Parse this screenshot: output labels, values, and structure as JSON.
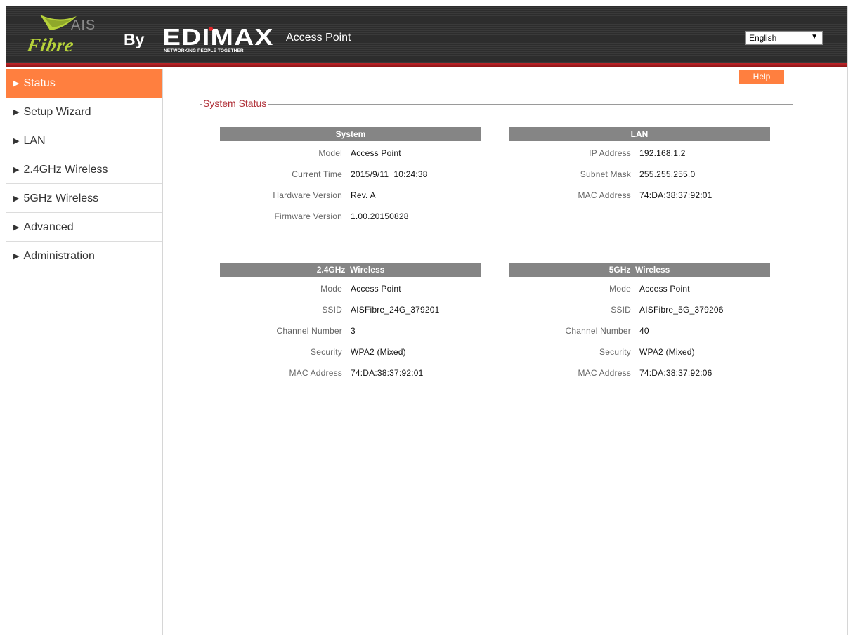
{
  "header": {
    "ais_text": "AIS",
    "fibre_text": "Fibre",
    "by_text": "By",
    "edimax_text": "EDIMAX",
    "edimax_tagline": "NETWORKING PEOPLE TOGETHER",
    "product_name": "Access Point",
    "language": "English"
  },
  "sidebar": {
    "items": [
      {
        "label": "Status",
        "active": true
      },
      {
        "label": "Setup Wizard"
      },
      {
        "label": "LAN"
      },
      {
        "label": "2.4GHz Wireless"
      },
      {
        "label": "5GHz Wireless"
      },
      {
        "label": "Advanced"
      },
      {
        "label": "Administration"
      }
    ]
  },
  "help_label": "Help",
  "status": {
    "legend": "System Status",
    "system": {
      "title": "System",
      "rows": [
        {
          "label": "Model",
          "value": "Access Point"
        },
        {
          "label": "Current Time",
          "value": "2015/9/11  10:24:38"
        },
        {
          "label": "Hardware Version",
          "value": "Rev. A"
        },
        {
          "label": "Firmware Version",
          "value": "1.00.20150828"
        }
      ]
    },
    "lan": {
      "title": "LAN",
      "rows": [
        {
          "label": "IP Address",
          "value": "192.168.1.2"
        },
        {
          "label": "Subnet Mask",
          "value": "255.255.255.0"
        },
        {
          "label": "MAC Address",
          "value": "74:DA:38:37:92:01"
        }
      ]
    },
    "wireless24": {
      "title": "2.4GHz  Wireless",
      "rows": [
        {
          "label": "Mode",
          "value": "Access Point"
        },
        {
          "label": "SSID",
          "value": "AISFibre_24G_379201"
        },
        {
          "label": "Channel Number",
          "value": "3"
        },
        {
          "label": "Security",
          "value": "WPA2 (Mixed)"
        },
        {
          "label": "MAC Address",
          "value": "74:DA:38:37:92:01"
        }
      ]
    },
    "wireless5": {
      "title": "5GHz  Wireless",
      "rows": [
        {
          "label": "Mode",
          "value": "Access Point"
        },
        {
          "label": "SSID",
          "value": "AISFibre_5G_379206"
        },
        {
          "label": "Channel Number",
          "value": "40"
        },
        {
          "label": "Security",
          "value": "WPA2 (Mixed)"
        },
        {
          "label": "MAC Address",
          "value": "74:DA:38:37:92:06"
        }
      ]
    }
  },
  "colors": {
    "accent": "#ff7f3f",
    "header_bg": "#2d2d2d",
    "header_stripe": "#c8282c",
    "section_header": "#858585",
    "legend_text": "#b03038",
    "fibre_green": "#b6d23a"
  }
}
